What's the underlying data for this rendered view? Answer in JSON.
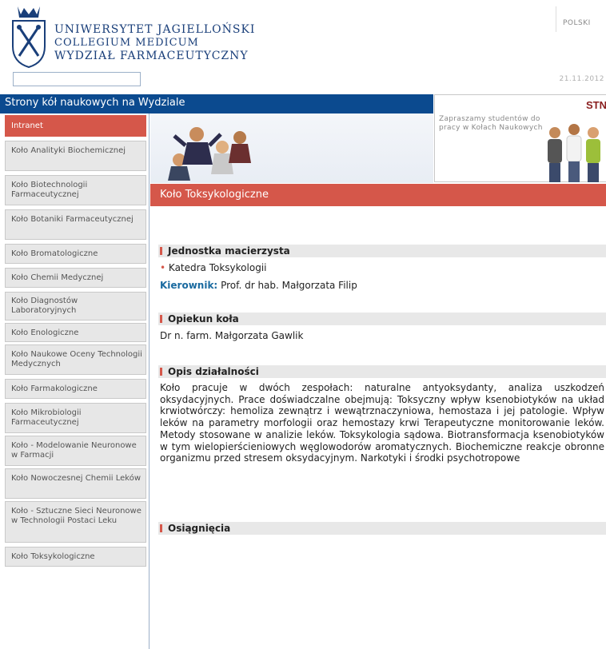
{
  "header": {
    "university_lines": [
      "UNIWERSYTET JAGIELLOŃSKI",
      "COLLEGIUM MEDICUM",
      "WYDZIAŁ FARMACEUTYCZNY"
    ],
    "language_link": "POLSKI",
    "search_value": "",
    "date": "21.11.2012"
  },
  "bar": {
    "title": "Strony kół naukowych na Wydziale"
  },
  "promo": {
    "logo_text": "STN",
    "text": "Zapraszamy studentów do pracy w Kołach Naukowych"
  },
  "sidebar": {
    "items": [
      {
        "label": "Intranet"
      },
      {
        "label": "Koło Analityki Biochemicznej"
      },
      {
        "label": "Koło Biotechnologii Farmaceutycznej"
      },
      {
        "label": "Koło Botaniki Farmaceutycznej"
      },
      {
        "label": "Koło Bromatologiczne"
      },
      {
        "label": "Koło Chemii Medycznej"
      },
      {
        "label": "Koło Diagnostów Laboratoryjnych"
      },
      {
        "label": "Koło Enologiczne"
      },
      {
        "label": "Koło Naukowe Oceny Technologii Medycznych"
      },
      {
        "label": "Koło Farmakologiczne"
      },
      {
        "label": "Koło Mikrobiologii Farmaceutycznej"
      },
      {
        "label": "Koło - Modelowanie Neuronowe w Farmacji"
      },
      {
        "label": "Koło Nowoczesnej Chemii Leków"
      },
      {
        "label": "Koło - Sztuczne Sieci Neuronowe w Technologii Postaci Leku"
      },
      {
        "label": "Koło Toksykologiczne"
      }
    ]
  },
  "main": {
    "section_title": "Koło Toksykologiczne",
    "unit_heading": "Jednostka macierzysta",
    "unit_bullet": "•",
    "unit_name": "Katedra Toksykologii",
    "head_label": "Kierownik:",
    "head_name": "Prof. dr hab. Małgorzata Filip",
    "supervisor_heading": "Opiekun koła",
    "supervisor_name": "Dr n. farm. Małgorzata Gawlik",
    "activity_heading": "Opis działalności",
    "activity_text": "Koło pracuje w dwóch zespołach: naturalne antyoksydanty, analiza uszkodzeń oksydacyjnych. Prace doświadczalne obejmują: Toksyczny wpływ ksenobiotyków na układ krwiotwórczy: hemoliza zewnątrz i wewątrznaczyniowa, hemostaza i jej patologie. Wpływ leków na parametry morfologii oraz hemostazy krwi Terapeutyczne monitorowanie leków. Metody stosowane w analizie leków. Toksykologia sądowa. Biotransformacja ksenobiotyków w tym wielopierścieniowych węglowodorów aromatycznych. Biochemiczne reakcje obronne organizmu przed stresem oksydacyjnym. Narkotyki i środki psychotropowe",
    "achievements_heading": "Osiągnięcia"
  },
  "colors": {
    "navy": "#0b4a8f",
    "accent_red": "#d5574a",
    "sidebar_bg": "#e7e7e7"
  }
}
